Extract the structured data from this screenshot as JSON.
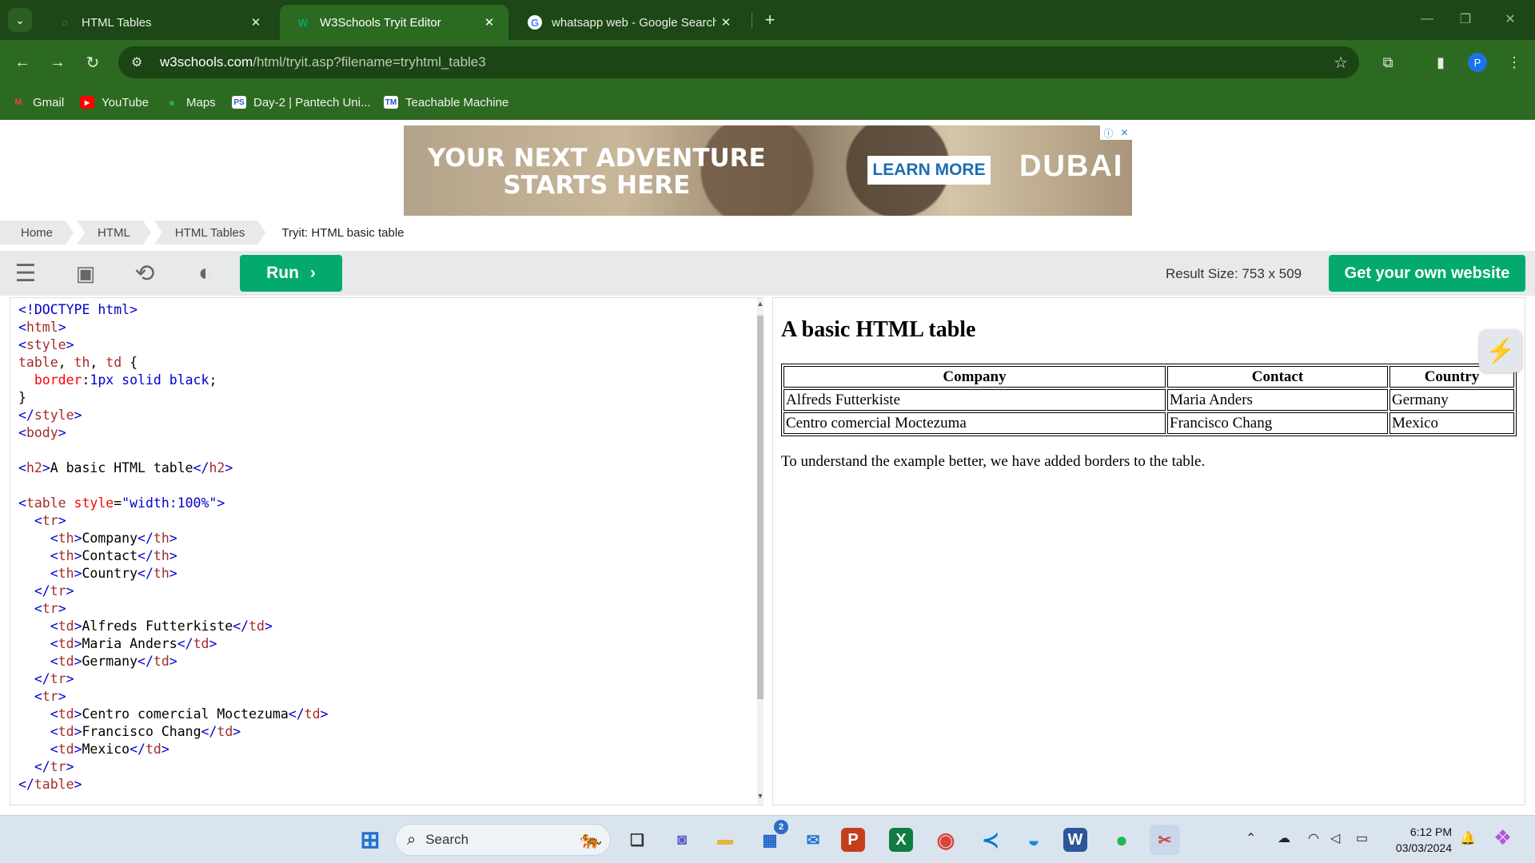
{
  "browser": {
    "tabs": [
      {
        "title": "HTML Tables",
        "icon": "w3schools-loading-icon",
        "active": false
      },
      {
        "title": "W3Schools Tryit Editor",
        "icon": "w3schools-icon",
        "active": true
      },
      {
        "title": "whatsapp web - Google Search",
        "icon": "google-icon",
        "active": false
      }
    ],
    "url_host": "w3schools.com",
    "url_path": "/html/tryit.asp?filename=tryhtml_table3",
    "profile_initial": "P",
    "bookmarks": [
      {
        "label": "Gmail",
        "icon": "gmail-icon",
        "color": "#ea4335"
      },
      {
        "label": "YouTube",
        "icon": "youtube-icon",
        "color": "#ff0000"
      },
      {
        "label": "Maps",
        "icon": "maps-icon",
        "color": "#34a853"
      },
      {
        "label": "Day-2 | Pantech Uni...",
        "icon": "pantech-icon",
        "color": "#2a63d4"
      },
      {
        "label": "Teachable Machine",
        "icon": "teachable-machine-icon",
        "color": "#1e56c6"
      }
    ]
  },
  "ad": {
    "headline_line1": "YOUR NEXT ADVENTURE",
    "headline_line2": "STARTS HERE",
    "cta": "LEARN MORE",
    "brand": "DUBAI"
  },
  "breadcrumb": [
    "Home",
    "HTML",
    "HTML Tables",
    "Tryit: HTML basic table"
  ],
  "editor": {
    "run_label": "Run",
    "result_size": "Result Size: 753 x 509",
    "own_site_label": "Get your own website"
  },
  "result": {
    "heading": "A basic HTML table",
    "headers": [
      "Company",
      "Contact",
      "Country"
    ],
    "rows": [
      [
        "Alfreds Futterkiste",
        "Maria Anders",
        "Germany"
      ],
      [
        "Centro comercial Moctezuma",
        "Francisco Chang",
        "Mexico"
      ]
    ],
    "note": "To understand the example better, we have added borders to the table."
  },
  "taskbar": {
    "search_placeholder": "Search",
    "time": "6:12 PM",
    "date": "03/03/2024",
    "store_badge": "2"
  }
}
